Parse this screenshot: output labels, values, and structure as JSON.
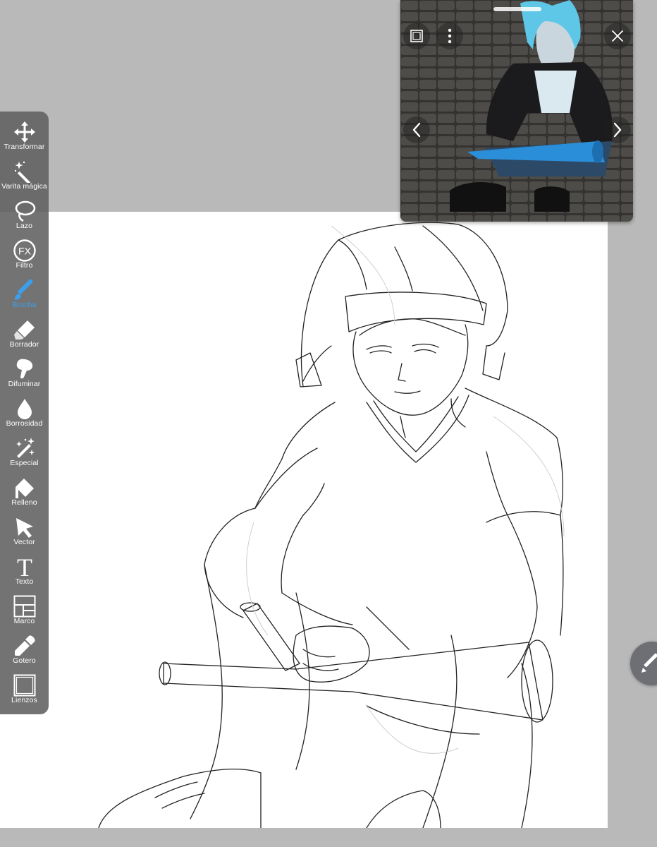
{
  "toolbar": {
    "items": [
      {
        "label": "Transformar",
        "icon": "move-arrows-icon"
      },
      {
        "label": "Varita mágica",
        "icon": "magic-wand-icon"
      },
      {
        "label": "Lazo",
        "icon": "lasso-icon"
      },
      {
        "label": "Filtro",
        "icon": "fx-filter-icon",
        "glyph": "FX"
      },
      {
        "label": "Brocha",
        "icon": "brush-icon",
        "active": true
      },
      {
        "label": "Borrador",
        "icon": "eraser-icon"
      },
      {
        "label": "Difuminar",
        "icon": "smudge-icon"
      },
      {
        "label": "Borrosidad",
        "icon": "blur-drop-icon"
      },
      {
        "label": "Especial",
        "icon": "special-sparkle-icon"
      },
      {
        "label": "Relleno",
        "icon": "fill-bucket-icon"
      },
      {
        "label": "Vector",
        "icon": "vector-arrow-icon"
      },
      {
        "label": "Texto",
        "icon": "text-icon",
        "glyph": "T"
      },
      {
        "label": "Marco",
        "icon": "frame-panels-icon"
      },
      {
        "label": "Gotero",
        "icon": "eyedropper-icon"
      },
      {
        "label": "Lienzos",
        "icon": "canvas-icon"
      }
    ]
  },
  "reference_window": {
    "close_icon": "close-icon",
    "more_icon": "more-vertical-icon",
    "frame_icon": "frame-toggle-icon",
    "prev_icon": "chevron-left-icon",
    "next_icon": "chevron-right-icon"
  },
  "fab": {
    "icon": "brush-pen-icon"
  },
  "colors": {
    "toolbar_bg": "#606060",
    "active_tool": "#3aa0ee",
    "workspace_bg": "#b9b9b9",
    "canvas_bg": "#ffffff"
  }
}
